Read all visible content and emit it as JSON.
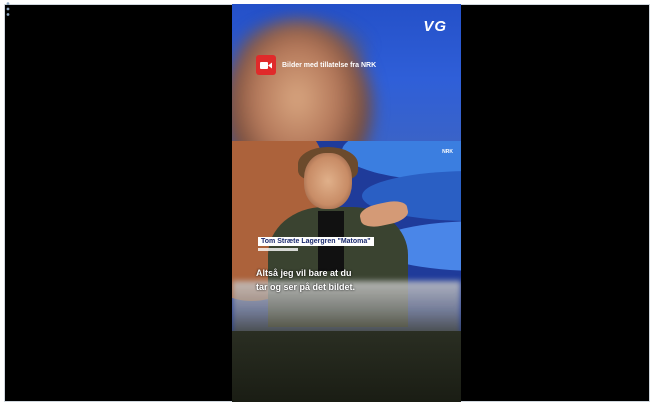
{
  "header": {
    "brand_logo": "VG",
    "credit_icon": "video-camera-icon",
    "credit_text": "Bilder med tillatelse fra NRK"
  },
  "studio": {
    "corner_logo": "NRK",
    "name_tag": "Tom Stræte Lagergren \"Matoma\"",
    "subtitle_line1": "Altså jeg vil bare at du",
    "subtitle_line2": "tar og ser på det bildet."
  },
  "colors": {
    "top_background": "#2f5fd8",
    "studio_background": "#1f3b9a",
    "badge_red": "#e02a2a",
    "letterbox": "#000000"
  }
}
